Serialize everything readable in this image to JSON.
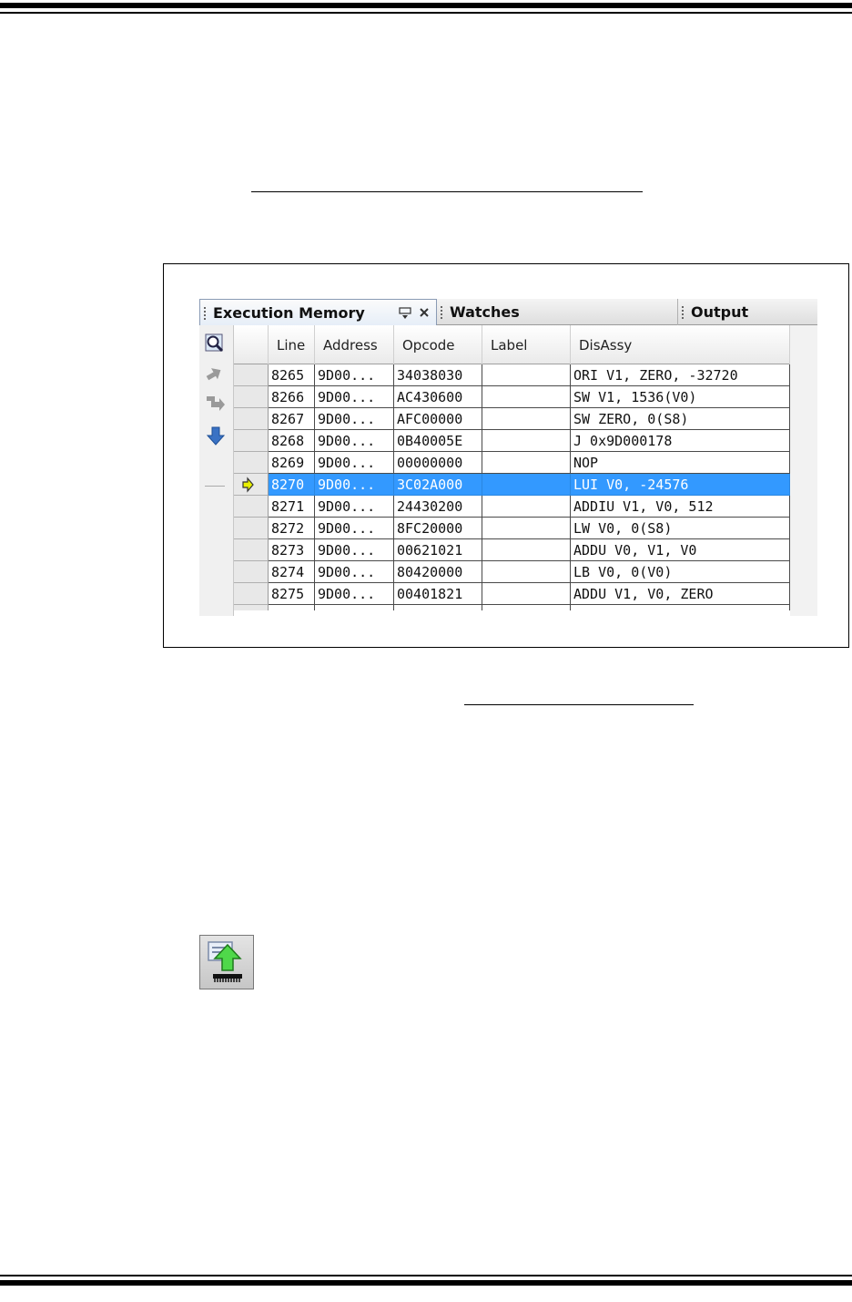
{
  "ide_panel": {
    "tabs": [
      {
        "label": "Execution Memory",
        "active": true
      },
      {
        "label": "Watches",
        "active": false
      },
      {
        "label": "Output",
        "active": false
      }
    ],
    "toolbar_icons": [
      "search-icon",
      "step-over-icon",
      "step-out-icon",
      "step-into-icon"
    ],
    "columns": [
      "Line",
      "Address",
      "Opcode",
      "Label",
      "DisAssy"
    ],
    "rows": [
      {
        "line": "8265",
        "address": "9D00...",
        "opcode": "34038030",
        "label": "",
        "disassy": "ORI V1, ZERO, -32720",
        "selected": false
      },
      {
        "line": "8266",
        "address": "9D00...",
        "opcode": "AC430600",
        "label": "",
        "disassy": "SW V1, 1536(V0)",
        "selected": false
      },
      {
        "line": "8267",
        "address": "9D00...",
        "opcode": "AFC00000",
        "label": "",
        "disassy": "SW ZERO, 0(S8)",
        "selected": false
      },
      {
        "line": "8268",
        "address": "9D00...",
        "opcode": "0B40005E",
        "label": "",
        "disassy": "J 0x9D000178",
        "selected": false
      },
      {
        "line": "8269",
        "address": "9D00...",
        "opcode": "00000000",
        "label": "",
        "disassy": "NOP",
        "selected": false
      },
      {
        "line": "8270",
        "address": "9D00...",
        "opcode": "3C02A000",
        "label": "",
        "disassy": "LUI V0, -24576",
        "selected": true
      },
      {
        "line": "8271",
        "address": "9D00...",
        "opcode": "24430200",
        "label": "",
        "disassy": "ADDIU V1, V0, 512",
        "selected": false
      },
      {
        "line": "8272",
        "address": "9D00...",
        "opcode": "8FC20000",
        "label": "",
        "disassy": "LW V0, 0(S8)",
        "selected": false
      },
      {
        "line": "8273",
        "address": "9D00...",
        "opcode": "00621021",
        "label": "",
        "disassy": "ADDU V0, V1, V0",
        "selected": false
      },
      {
        "line": "8274",
        "address": "9D00...",
        "opcode": "80420000",
        "label": "",
        "disassy": "LB V0, 0(V0)",
        "selected": false
      },
      {
        "line": "8275",
        "address": "9D00...",
        "opcode": "00401821",
        "label": "",
        "disassy": "ADDU V1, V0, ZERO",
        "selected": false
      }
    ],
    "colors": {
      "selection": "#3399ff",
      "execution_arrow": "#e8f000"
    }
  },
  "program_icon": {
    "icon": "program-device-upload-icon"
  }
}
